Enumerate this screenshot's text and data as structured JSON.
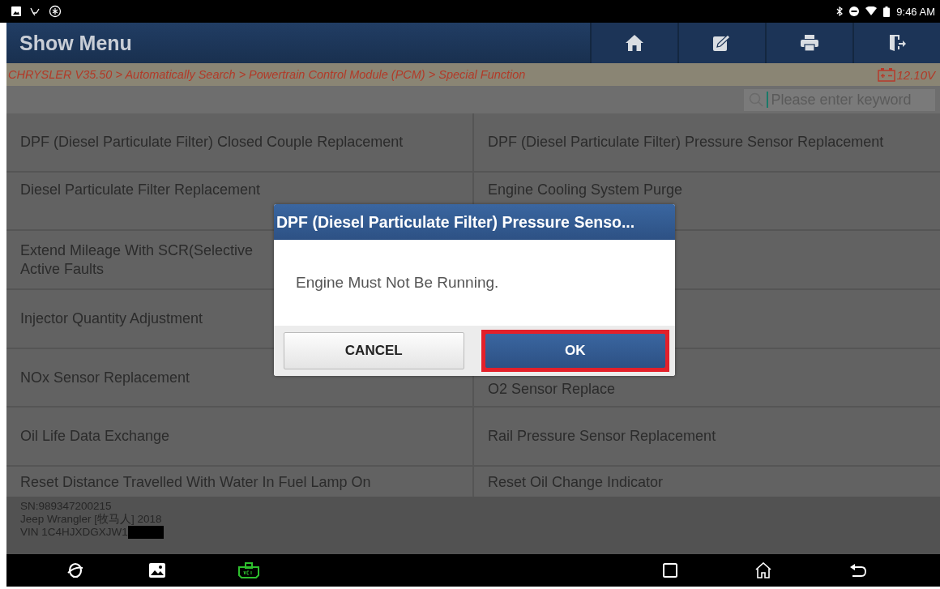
{
  "status_bar": {
    "time": "9:46 AM"
  },
  "header": {
    "title": "Show Menu"
  },
  "breadcrumb": {
    "path": "CHRYSLER V35.50 > Automatically Search > Powertrain Control Module (PCM) > Special Function",
    "voltage": "12.10V"
  },
  "search": {
    "placeholder": "Please enter keyword"
  },
  "menu_rows": [
    {
      "left": [
        "DPF (Diesel Particulate Filter) Closed Couple Replacement"
      ],
      "right": [
        "DPF (Diesel Particulate Filter) Pressure Sensor Replacement"
      ]
    },
    {
      "left": [
        "Diesel Particulate Filter Replacement"
      ],
      "right": [
        "Engine Cooling System Purge"
      ]
    },
    {
      "left": [
        "Extend Mileage With SCR(Selective",
        "Active Faults"
      ]
    },
    {
      "left": [
        "Injector Quantity Adjustment"
      ]
    },
    {
      "left": [
        "NOx Sensor Replacement"
      ],
      "right": [
        "O2 Sensor Replace"
      ]
    },
    {
      "left": [
        "Oil Life Data Exchange"
      ],
      "right": [
        "Rail Pressure Sensor Replacement"
      ]
    },
    {
      "left": [
        "Reset Distance Travelled With Water In Fuel Lamp On"
      ],
      "right": [
        "Reset Oil Change Indicator"
      ]
    }
  ],
  "vehicle_info": {
    "serial": "SN:989347200215",
    "model": "Jeep Wrangler [牧马人] 2018",
    "vin": "VIN 1C4HJXDGXJW1"
  },
  "dialog": {
    "title": "DPF (Diesel Particulate Filter) Pressure Senso...",
    "message": "Engine Must Not Be Running.",
    "buttons": [
      {
        "label": "CANCEL",
        "kind": "secondary",
        "highlighted": false
      },
      {
        "label": "OK",
        "kind": "primary",
        "highlighted": true
      }
    ]
  }
}
